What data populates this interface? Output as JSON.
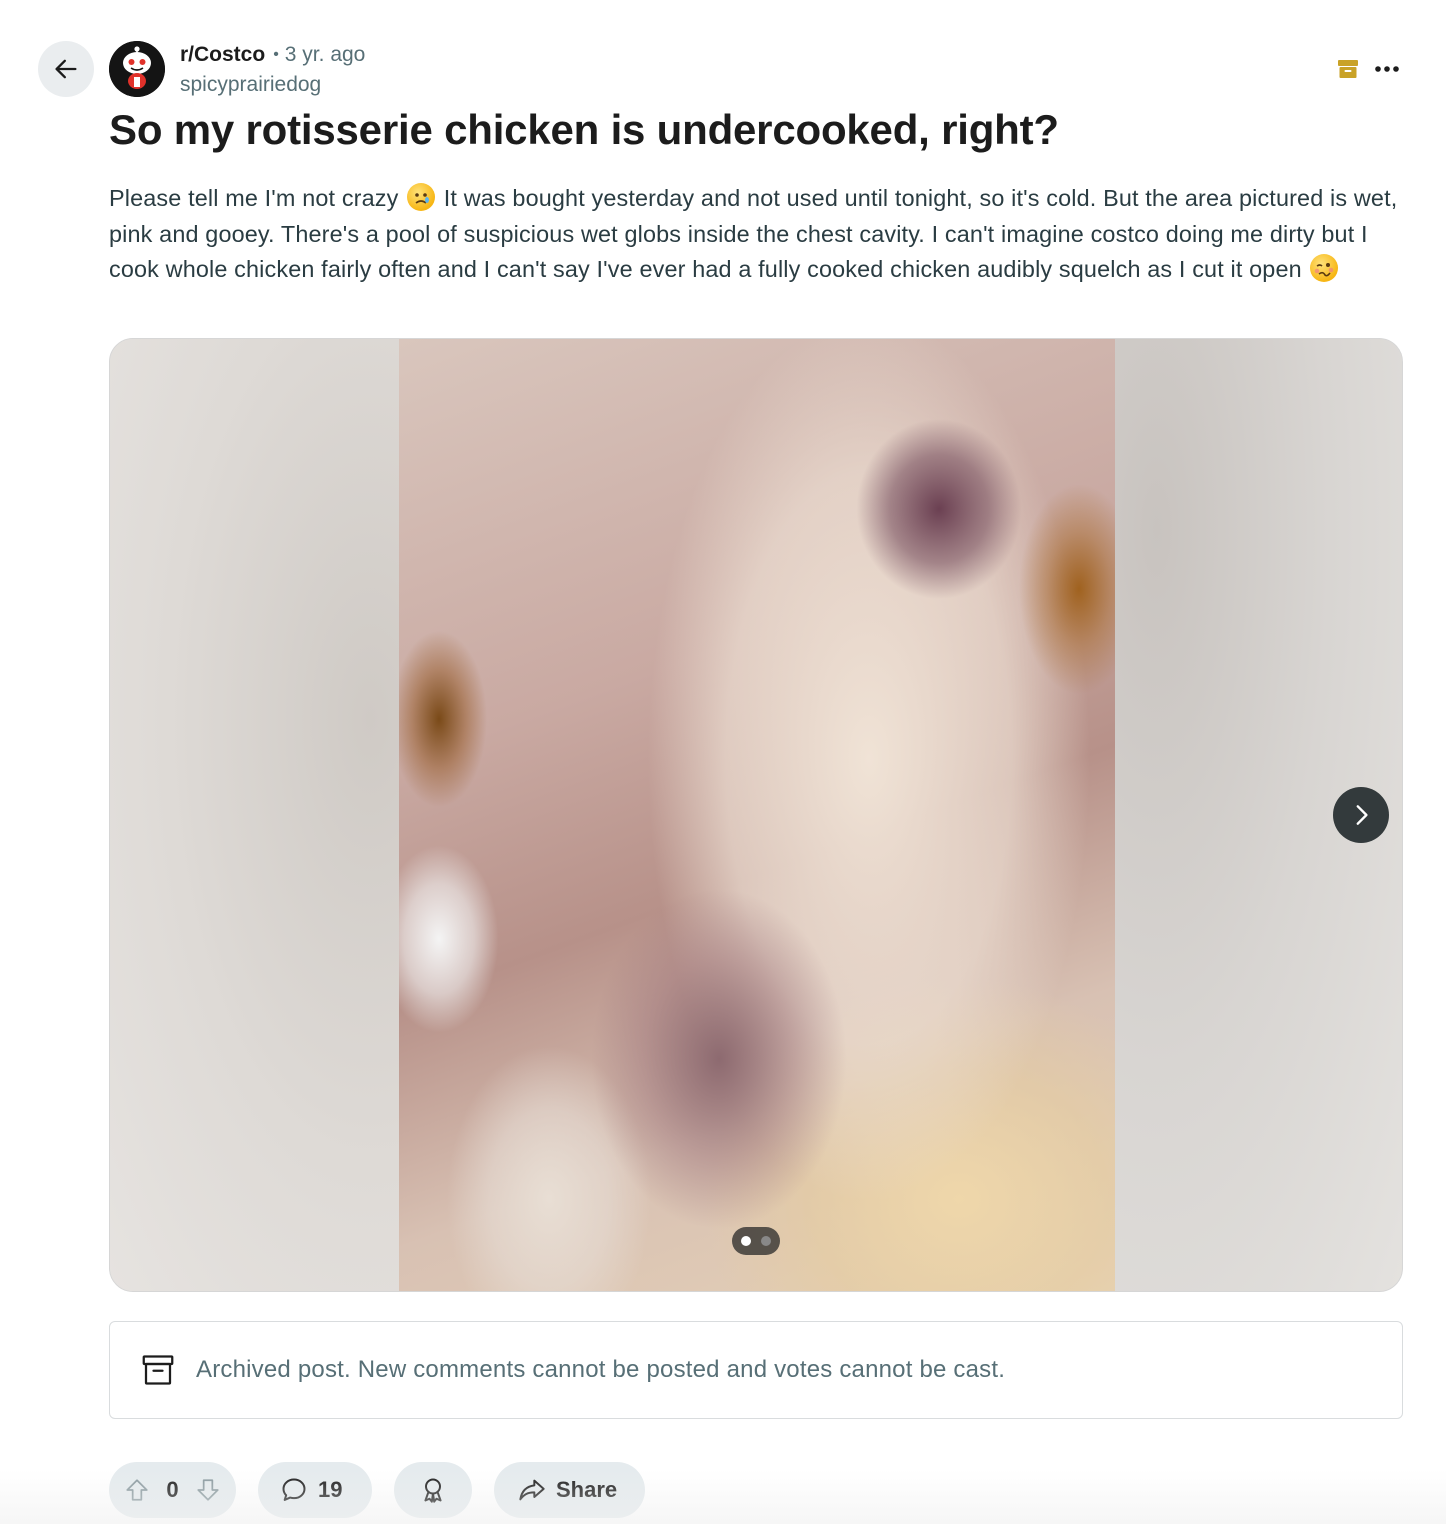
{
  "post": {
    "subreddit": "r/Costco",
    "separator": "•",
    "age": "3 yr. ago",
    "author": "spicyprairiedog",
    "title": "So my rotisserie chicken is undercooked, right?",
    "body_part1": "Please tell me I'm not crazy",
    "body_part2": " It was bought yesterday and not used until tonight, so it's cold. But the area pictured is wet, pink and gooey. There's a pool of suspicious wet globs inside the chest cavity. I can't imagine costco doing me dirty but I cook whole chicken fairly often and I can't say I've ever had a fully cooked chicken audibly squelch as I cut it open",
    "emoji1": "crying-face",
    "emoji2": "woozy-face"
  },
  "gallery": {
    "image_description_icon": "chicken-photo",
    "total_images": 2,
    "current_index": 1
  },
  "archived_notice": "Archived post. New comments cannot be posted and votes cannot be cast.",
  "actions": {
    "votes": "0",
    "comments": "19",
    "share_label": "Share"
  },
  "colors": {
    "back_button_bg": "#eaedef",
    "pill_bg": "#e5ebee",
    "archive_icon": "#c9a227",
    "muted_text": "#576f76"
  }
}
